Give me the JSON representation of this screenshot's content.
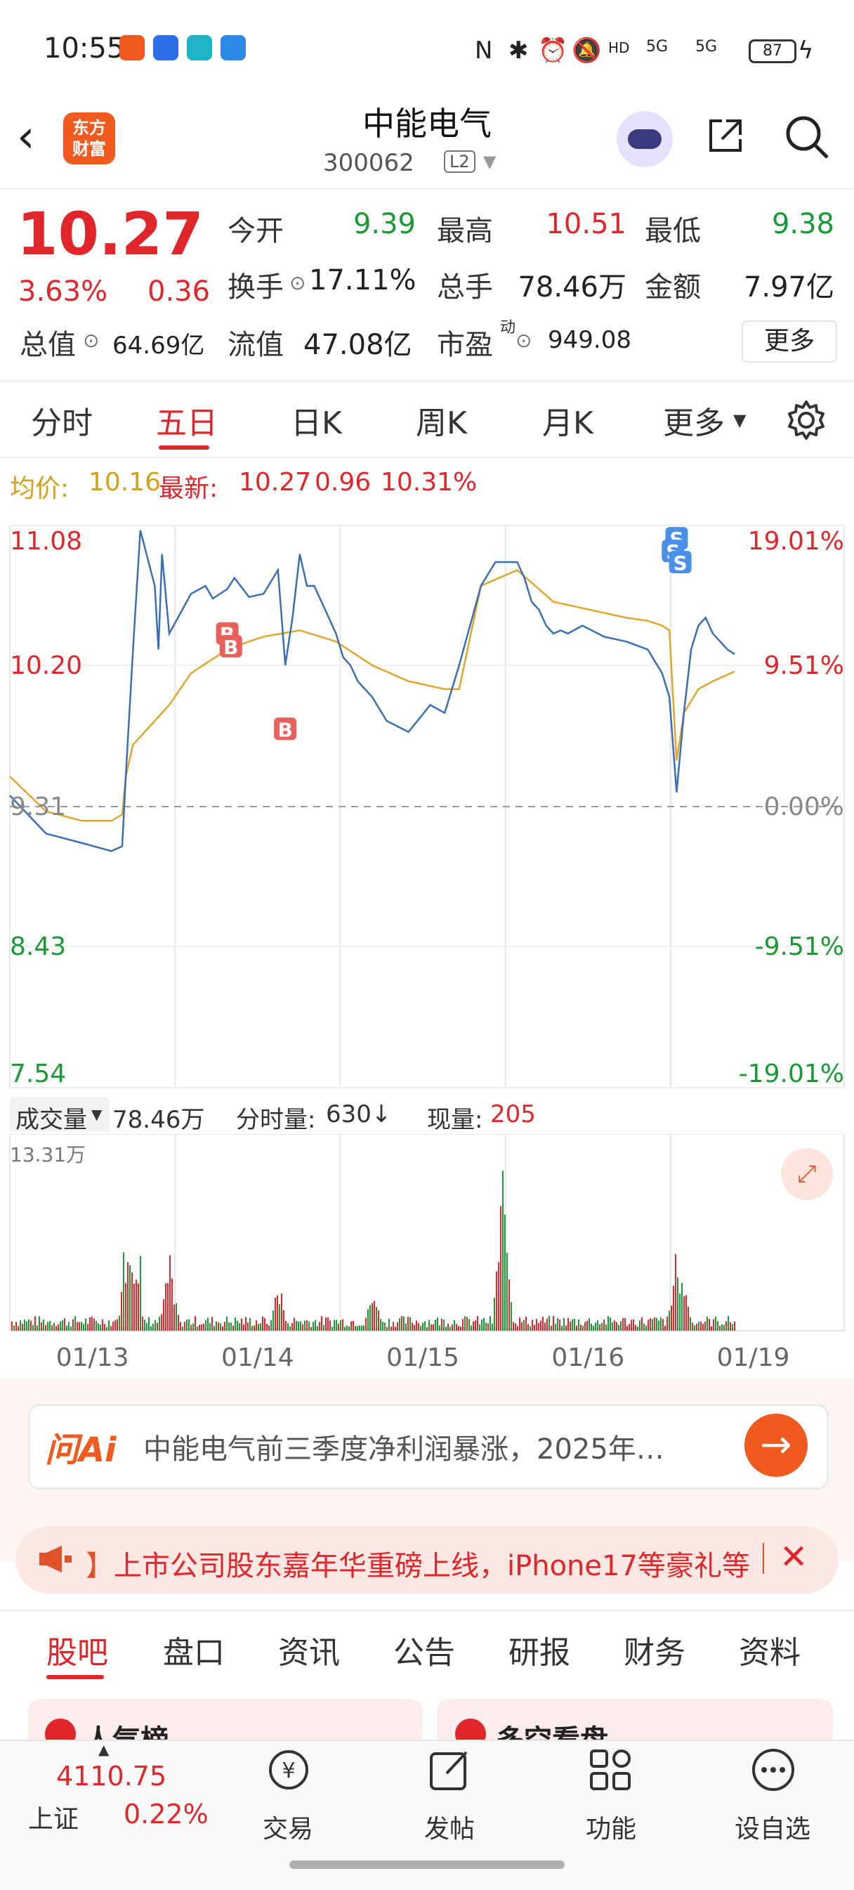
{
  "status_bar": {
    "time": "10:55",
    "battery": "87",
    "network": "5G"
  },
  "header": {
    "logo_text_1": "东方",
    "logo_text_2": "财富",
    "stock_name": "中能电气",
    "stock_code": "300062",
    "level": "L2"
  },
  "quote": {
    "price": "10.27",
    "change_pct": "3.63%",
    "change": "0.36",
    "open_label": "今开",
    "open": "9.39",
    "high_label": "最高",
    "high": "10.51",
    "low_label": "最低",
    "low": "9.38",
    "turnover_label": "换手",
    "turnover": "17.11%",
    "volume_label": "总手",
    "volume": "78.46万",
    "amount_label": "金额",
    "amount": "7.97亿",
    "mcap_label": "总值",
    "mcap": "64.69亿",
    "float_label": "流值",
    "float": "47.08亿",
    "pe_label": "市盈",
    "pe_sup": "动",
    "pe": "949.08",
    "more": "更多"
  },
  "chart_tabs": [
    "分时",
    "五日",
    "日K",
    "周K",
    "月K",
    "更多"
  ],
  "chart_legend": {
    "avg_label": "均价:",
    "avg": "10.16",
    "latest_label": "最新:",
    "latest": "10.27",
    "latest_change": "0.96",
    "latest_pct": "10.31%"
  },
  "chart_data": {
    "type": "line",
    "title": "",
    "x": [
      "01/13",
      "01/14",
      "01/15",
      "01/16",
      "01/19"
    ],
    "y_ticks_left": [
      "11.08",
      "10.20",
      "9.31",
      "8.43",
      "7.54"
    ],
    "y_ticks_right": [
      "19.01%",
      "9.51%",
      "0.00%",
      "-9.51%",
      "-19.01%"
    ],
    "ylim": [
      7.54,
      11.08
    ],
    "prev_close": 9.31,
    "series": [
      {
        "name": "最新",
        "color": "#3a6fb6",
        "x": [
          0,
          0.05,
          0.1,
          0.14,
          0.155,
          0.16,
          0.17,
          0.18,
          0.2,
          0.205,
          0.21,
          0.22,
          0.25,
          0.27,
          0.28,
          0.29,
          0.3,
          0.31,
          0.33,
          0.35,
          0.37,
          0.38,
          0.39,
          0.4,
          0.41,
          0.42,
          0.43,
          0.45,
          0.46,
          0.47,
          0.48,
          0.49,
          0.5,
          0.52,
          0.55,
          0.58,
          0.6,
          0.62,
          0.65,
          0.67,
          0.69,
          0.7,
          0.71,
          0.72,
          0.73,
          0.74,
          0.75,
          0.76,
          0.77,
          0.79,
          0.82,
          0.85,
          0.88,
          0.9,
          0.91,
          0.92,
          0.93,
          0.94,
          0.95,
          0.96,
          0.97,
          0.98,
          0.99,
          1.0
        ],
        "y": [
          9.38,
          9.14,
          9.08,
          9.03,
          9.06,
          9.5,
          10.3,
          11.05,
          10.7,
          10.3,
          10.9,
          10.4,
          10.65,
          10.7,
          10.62,
          10.65,
          10.68,
          10.75,
          10.63,
          10.65,
          10.8,
          10.2,
          10.5,
          10.9,
          10.7,
          10.7,
          10.6,
          10.4,
          10.25,
          10.2,
          10.1,
          10.05,
          10.0,
          9.85,
          9.78,
          9.95,
          9.9,
          10.2,
          10.7,
          10.85,
          10.85,
          10.85,
          10.75,
          10.6,
          10.55,
          10.45,
          10.4,
          10.42,
          10.4,
          10.45,
          10.38,
          10.35,
          10.3,
          10.15,
          10.0,
          9.4,
          9.9,
          10.3,
          10.45,
          10.5,
          10.4,
          10.35,
          10.3,
          10.27
        ]
      },
      {
        "name": "均价",
        "color": "#e0a52c",
        "x": [
          0,
          0.05,
          0.1,
          0.14,
          0.155,
          0.16,
          0.17,
          0.2,
          0.22,
          0.25,
          0.3,
          0.33,
          0.35,
          0.4,
          0.45,
          0.5,
          0.55,
          0.6,
          0.62,
          0.65,
          0.7,
          0.75,
          0.8,
          0.85,
          0.88,
          0.9,
          0.91,
          0.92,
          0.93,
          0.95,
          0.97,
          1.0
        ],
        "y": [
          9.5,
          9.28,
          9.22,
          9.22,
          9.26,
          9.5,
          9.7,
          9.85,
          9.95,
          10.15,
          10.3,
          10.35,
          10.38,
          10.42,
          10.35,
          10.2,
          10.1,
          10.05,
          10.05,
          10.7,
          10.8,
          10.6,
          10.55,
          10.5,
          10.48,
          10.45,
          10.42,
          9.6,
          9.9,
          10.05,
          10.1,
          10.16
        ]
      }
    ],
    "trade_marks": [
      {
        "type": "B",
        "x": 0.3,
        "y": 10.4
      },
      {
        "type": "B",
        "x": 0.305,
        "y": 10.32
      },
      {
        "type": "B",
        "x": 0.38,
        "y": 9.8
      },
      {
        "type": "S",
        "x": 0.92,
        "y": 11.0
      },
      {
        "type": "S",
        "x": 0.915,
        "y": 10.92
      },
      {
        "type": "S",
        "x": 0.925,
        "y": 10.85
      }
    ]
  },
  "volume_panel": {
    "label": "成交量",
    "total": "78.46万",
    "tick_label": "分时量:",
    "tick_value": "630↓",
    "now_label": "现量:",
    "now_value": "205",
    "max": "13.31万"
  },
  "ai_banner": {
    "logo": "问Ai",
    "text": "中能电气前三季度净利润暴涨，2025年…"
  },
  "notice": {
    "bracket": "】",
    "text": "上市公司股东嘉年华重磅上线，iPhone17等豪礼等"
  },
  "lower_tabs": [
    "股吧",
    "盘口",
    "资讯",
    "公告",
    "研报",
    "财务",
    "资料"
  ],
  "cards": [
    "人气榜",
    "多空看盘"
  ],
  "bottom_nav": {
    "index_value": "4110.75",
    "index_name": "上证",
    "index_pct": "0.22%",
    "items": [
      "交易",
      "发帖",
      "功能",
      "设自选"
    ]
  }
}
